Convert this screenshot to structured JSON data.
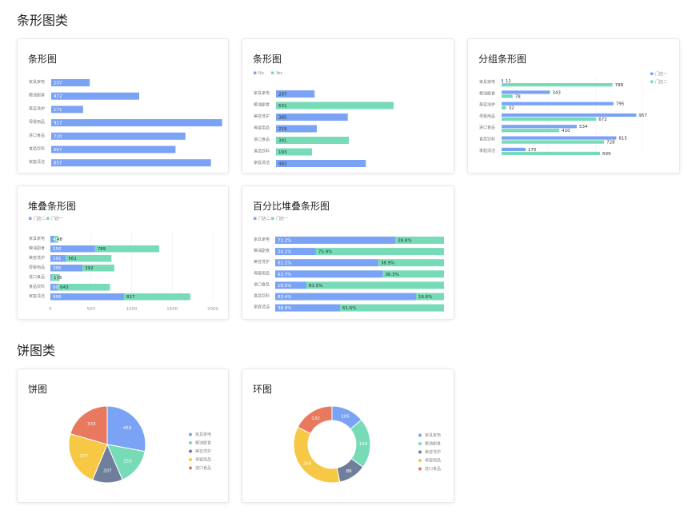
{
  "sections": {
    "bar": "条形图类",
    "pie": "饼图类"
  },
  "colors": {
    "blue": "#7aa3f5",
    "green": "#76dbb6",
    "slate": "#6f7f9b",
    "yellow": "#f7c844",
    "red": "#e8795f"
  },
  "cards": [
    {
      "title": "条形图"
    },
    {
      "title": "条形图"
    },
    {
      "title": "分组条形图"
    },
    {
      "title": "堆叠条形图"
    },
    {
      "title": "百分比堆叠条形图"
    },
    {
      "title": "饼图"
    },
    {
      "title": "环图"
    }
  ],
  "chart_data": [
    {
      "type": "bar",
      "title": "条形图",
      "categories": [
        "家具家电",
        "粮油副食",
        "美容洗护",
        "母婴用品",
        "进口食品",
        "食品饮料",
        "家庭清洁"
      ],
      "values": [
        207,
        472,
        171,
        917,
        720,
        667,
        857
      ],
      "xlim": [
        0,
        1000
      ]
    },
    {
      "type": "bar",
      "title": "条形图",
      "legend": [
        "No",
        "Yes"
      ],
      "categories": [
        "家具家电",
        "粮油副食",
        "美容洗护",
        "母婴用品",
        "进口食品",
        "食品饮料",
        "家庭清洁"
      ],
      "values": [
        207,
        631,
        385,
        219,
        391,
        193,
        482
      ],
      "groups": [
        "No",
        "Yes",
        "No",
        "No",
        "Yes",
        "Yes",
        "No"
      ],
      "xlim": [
        0,
        1000
      ]
    },
    {
      "type": "bar",
      "title": "分组条形图",
      "categories": [
        "家具家电",
        "粮油副食",
        "美容洗护",
        "母婴用品",
        "进口食品",
        "食品饮料",
        "家庭清洁"
      ],
      "series": [
        {
          "name": "门店一",
          "values": [
            11,
            343,
            795,
            957,
            534,
            815,
            170
          ]
        },
        {
          "name": "门店二",
          "values": [
            788,
            78,
            32,
            672,
            410,
            728,
            699
          ]
        }
      ],
      "xlim": [
        0,
        1000
      ]
    },
    {
      "type": "bar",
      "title": "堆叠条形图",
      "categories": [
        "家具家电",
        "粮油副食",
        "美容洗护",
        "母婴用品",
        "进口食品",
        "食品饮料",
        "家庭清洁"
      ],
      "series": [
        {
          "name": "门店二",
          "values": [
            48,
            550,
            191,
            395,
            10,
            90,
            906
          ]
        },
        {
          "name": "门店一",
          "values": [
            48,
            789,
            561,
            392,
            105,
            643,
            817
          ]
        }
      ],
      "xticks": [
        "0",
        "500",
        "1000",
        "1500",
        "2000"
      ],
      "xlim": [
        0,
        2000
      ]
    },
    {
      "type": "bar",
      "title": "百分比堆叠条形图",
      "categories": [
        "家具家电",
        "粮油副食",
        "美容洗护",
        "母婴用品",
        "进口食品",
        "食品饮料",
        "家庭清洁"
      ],
      "series": [
        {
          "name": "门店二",
          "values": [
            71.2,
            24.1,
            61.1,
            63.7,
            18.5,
            83.4,
            38.4
          ]
        },
        {
          "name": "门店一",
          "values": [
            28.8,
            75.9,
            38.9,
            36.3,
            81.5,
            16.6,
            61.6
          ]
        }
      ],
      "labels_a": [
        "71.2%",
        "24.1%",
        "61.1%",
        "63.7%",
        "18.5%",
        "83.4%",
        "38.4%"
      ],
      "labels_b": [
        "28.8%",
        "75.9%",
        "38.9%",
        "36.3%",
        "81.5%",
        "16.6%",
        "61.6%"
      ]
    },
    {
      "type": "pie",
      "title": "饼图",
      "categories": [
        "家具家电",
        "粮油副食",
        "美容洗护",
        "母婴用品",
        "进口食品"
      ],
      "values": [
        453,
        253,
        207,
        377,
        333
      ]
    },
    {
      "type": "pie",
      "title": "环图",
      "donut": true,
      "categories": [
        "家具家电",
        "粮油副食",
        "美容洗护",
        "母婴用品",
        "进口食品"
      ],
      "values": [
        105,
        159,
        88,
        269,
        132
      ]
    }
  ]
}
